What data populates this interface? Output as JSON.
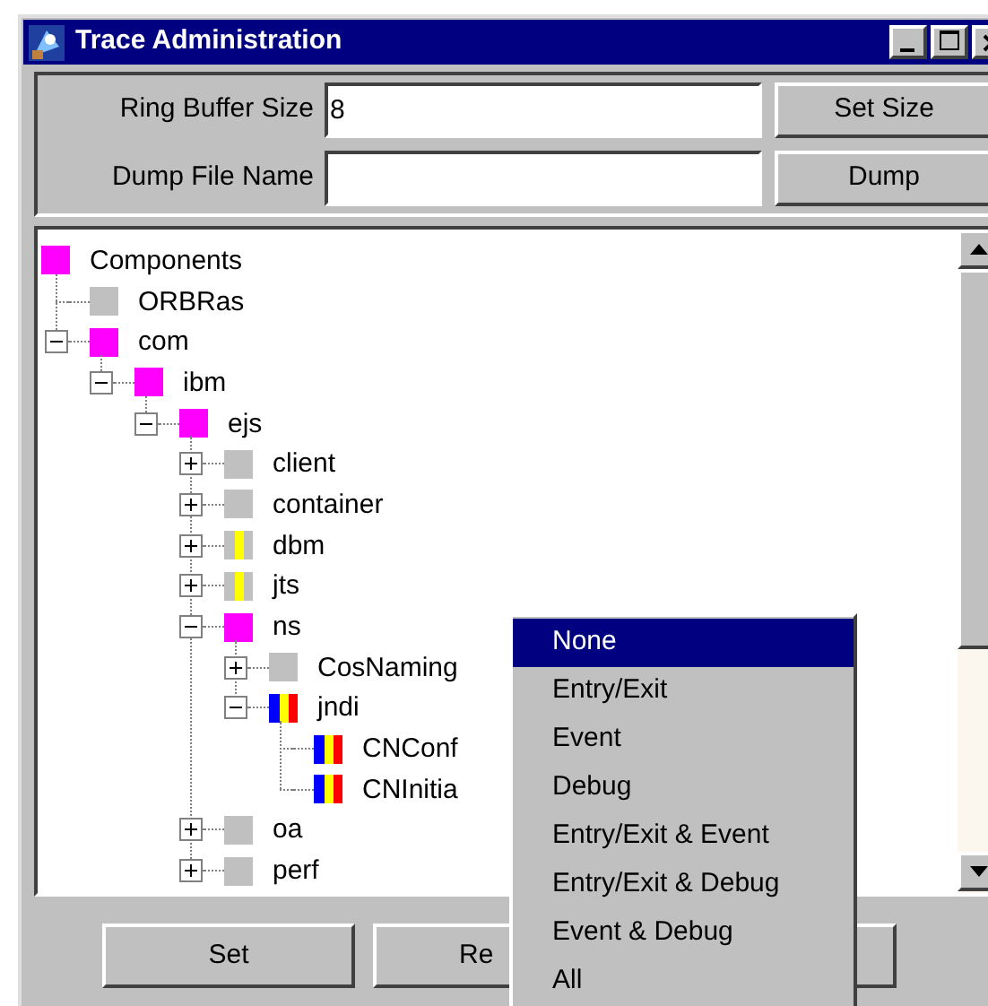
{
  "window": {
    "title": "Trace Administration"
  },
  "settings": [
    {
      "label": "Ring Buffer Size",
      "value": "8",
      "button": "Set Size"
    },
    {
      "label": "Dump File Name",
      "button": "Dump"
    }
  ],
  "tree": {
    "label": "Components",
    "kind": "full",
    "children": [
      {
        "label": "ORBRas",
        "kind": "off"
      },
      {
        "label": "com",
        "kind": "full",
        "expanded": true,
        "children": [
          {
            "label": "ibm",
            "kind": "full",
            "expanded": true,
            "children": [
              {
                "label": "ejs",
                "kind": "full",
                "expanded": true,
                "children": [
                  {
                    "label": "client",
                    "kind": "off",
                    "expanded": false
                  },
                  {
                    "label": "container",
                    "kind": "off",
                    "expanded": false
                  },
                  {
                    "label": "dbm",
                    "kind": "partial",
                    "expanded": false
                  },
                  {
                    "label": "jts",
                    "kind": "partial",
                    "expanded": false
                  },
                  {
                    "label": "ns",
                    "kind": "full",
                    "expanded": true,
                    "children": [
                      {
                        "label": "CosNaming",
                        "kind": "off",
                        "expanded": false
                      },
                      {
                        "label": "jndi",
                        "kind": "mixed",
                        "expanded": true,
                        "children": [
                          {
                            "label": "CNConf",
                            "kind": "mixed"
                          },
                          {
                            "label": "CNInitia",
                            "kind": "mixed"
                          }
                        ]
                      }
                    ]
                  },
                  {
                    "label": "oa",
                    "kind": "off",
                    "expanded": false
                  },
                  {
                    "label": "perf",
                    "kind": "off",
                    "expanded": false
                  }
                ]
              }
            ]
          }
        ]
      }
    ]
  },
  "buttons": [
    "Set",
    "Re"
  ],
  "context_menu": [
    {
      "label": "None",
      "selected": true
    },
    {
      "label": "Entry/Exit",
      "selected": false
    },
    {
      "label": "Event",
      "selected": false
    },
    {
      "label": "Debug",
      "selected": false
    },
    {
      "label": "Entry/Exit & Event",
      "selected": false
    },
    {
      "label": "Entry/Exit & Debug",
      "selected": false
    },
    {
      "label": "Event & Debug",
      "selected": false
    },
    {
      "label": "All",
      "selected": false
    }
  ]
}
